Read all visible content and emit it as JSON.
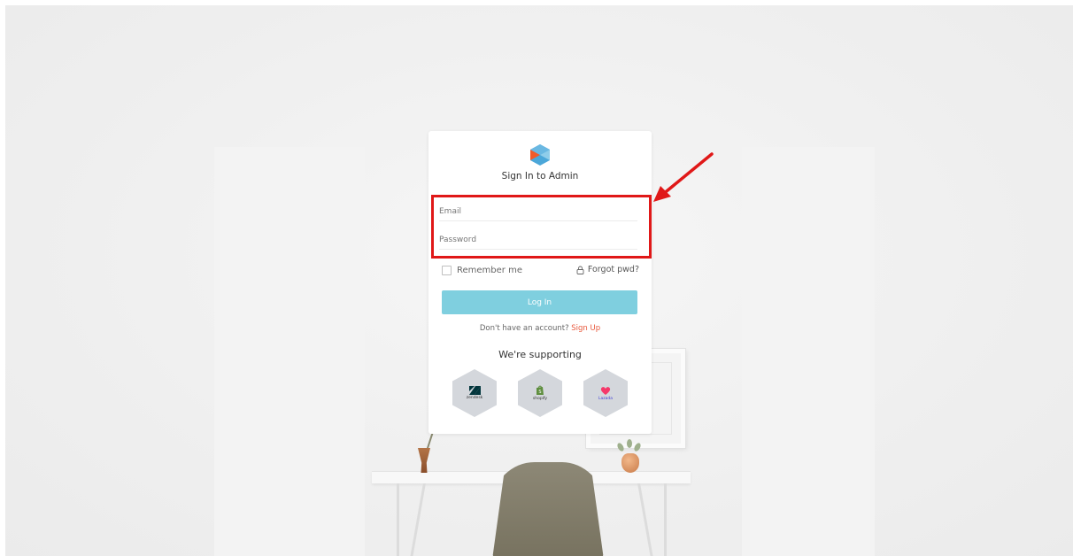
{
  "card": {
    "title": "Sign In to Admin",
    "email_placeholder": "Email",
    "password_placeholder": "Password",
    "remember_label": "Remember me",
    "forgot_label": "Forgot pwd?",
    "login_label": "Log In",
    "signup_prompt": "Don't have an account?",
    "signup_link": "Sign Up",
    "supporting_title": "We're supporting"
  },
  "partners": [
    {
      "name": "zendesk",
      "icon": "zendesk-logo-icon"
    },
    {
      "name": "shopify",
      "icon": "shopify-logo-icon"
    },
    {
      "name": "Lazada",
      "icon": "lazada-logo-icon"
    }
  ],
  "colors": {
    "login_button": "#7fcfdf",
    "signup_link": "#e8593d",
    "annotation": "#e01818",
    "logo_blue": "#4ba7d9",
    "logo_orange": "#f15a29"
  },
  "annotation": {
    "target": "email-and-password-fields",
    "icon": "red-arrow-icon"
  }
}
